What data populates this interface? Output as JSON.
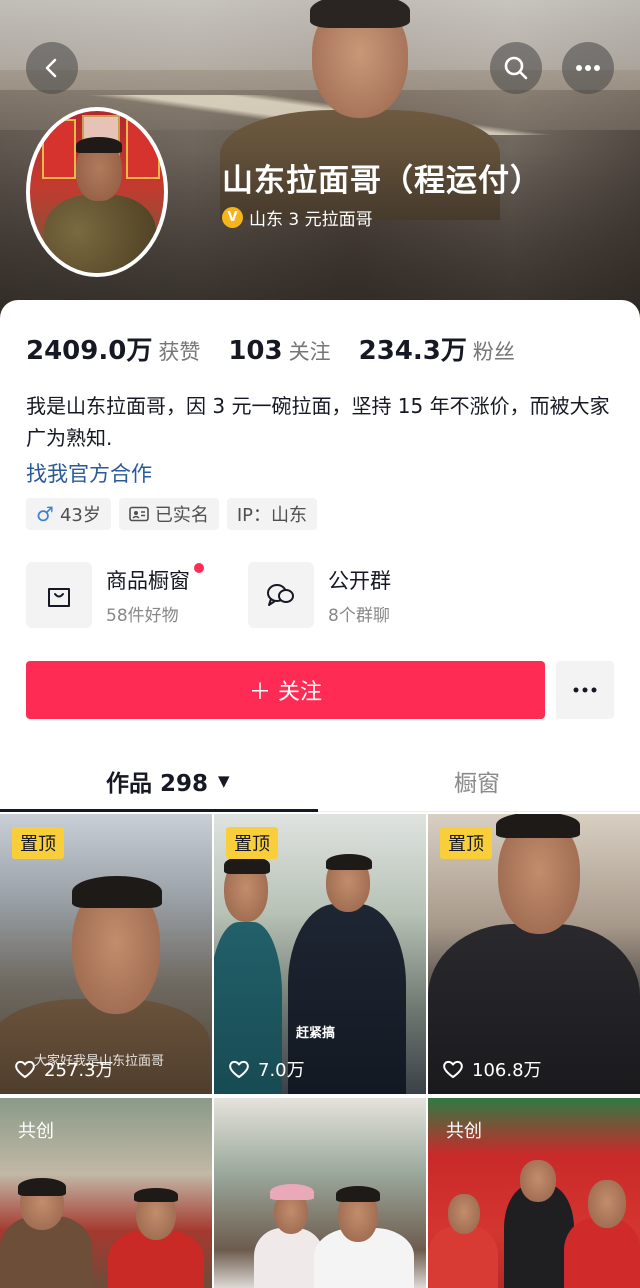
{
  "profile": {
    "name": "山东拉面哥（程运付）",
    "verify_text": "山东 3 元拉面哥",
    "verify_badge": "V"
  },
  "stats": [
    {
      "value": "2409.0万",
      "label": "获赞"
    },
    {
      "value": "103",
      "label": "关注"
    },
    {
      "value": "234.3万",
      "label": "粉丝"
    }
  ],
  "bio": "我是山东拉面哥，因 3 元一碗拉面，坚持 15 年不涨价，而被大家广为熟知.",
  "coop_link": "找我官方合作",
  "tags": [
    {
      "icon": "male-icon",
      "glyph": "♂",
      "text": "43岁"
    },
    {
      "icon": "id-card-icon",
      "text": "已实名"
    },
    {
      "text": "IP：山东"
    }
  ],
  "shortcuts": [
    {
      "title": "商品橱窗",
      "sub": "58件好物",
      "icon": "shopping-bag-icon",
      "has_dot": true
    },
    {
      "title": "公开群",
      "sub": "8个群聊",
      "icon": "group-chat-icon",
      "has_dot": false
    }
  ],
  "follow_label": "＋ 关注",
  "tabs": {
    "works_label": "作品 298",
    "works_arrow": "▼",
    "window_label": "橱窗"
  },
  "videos": [
    {
      "badge": "置顶",
      "likes": "257.3万",
      "caption": "大家好我是山东拉面哥"
    },
    {
      "badge": "置顶",
      "likes": "7.0万",
      "caption": "赶紧搞"
    },
    {
      "badge": "置顶",
      "likes": "106.8万"
    },
    {
      "badge": "共创"
    },
    {},
    {
      "badge": "共创"
    }
  ],
  "colors": {
    "accent": "#fe2c55",
    "pin_badge": "#f8cf3b",
    "link": "#2a5a9a"
  }
}
